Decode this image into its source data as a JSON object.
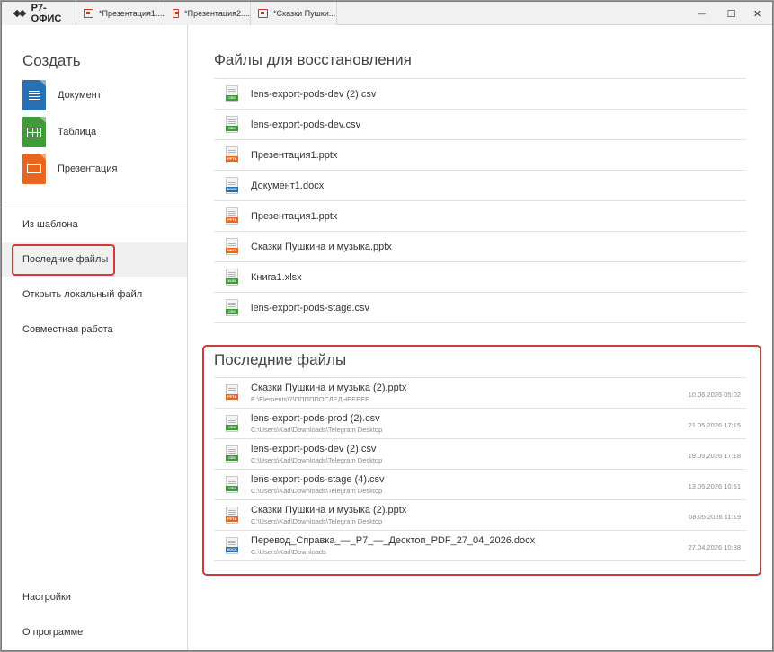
{
  "titlebar": {
    "brand": "Р7-ОФИС",
    "tabs": [
      {
        "label": "*Презентация1...."
      },
      {
        "label": "*Презентация2...."
      },
      {
        "label": "*Сказки Пушки..."
      }
    ],
    "minimize": "—",
    "maximize": "☐",
    "close": "✕"
  },
  "sidebar": {
    "create_title": "Создать",
    "create_items": [
      {
        "label": "Документ",
        "color": "#2a6fb0"
      },
      {
        "label": "Таблица",
        "color": "#3f9a3a"
      },
      {
        "label": "Презентация",
        "color": "#e9661f"
      }
    ],
    "nav": [
      {
        "label": "Из шаблона"
      },
      {
        "label": "Последние файлы"
      },
      {
        "label": "Открыть локальный файл"
      },
      {
        "label": "Совместная работа"
      }
    ],
    "bottom": [
      {
        "label": "Настройки"
      },
      {
        "label": "О программе"
      }
    ]
  },
  "recovery": {
    "title": "Файлы для восстановления",
    "files": [
      {
        "name": "lens-export-pods-dev (2).csv",
        "type": "CSV"
      },
      {
        "name": "lens-export-pods-dev.csv",
        "type": "CSV"
      },
      {
        "name": "Презентация1.pptx",
        "type": "PPTX"
      },
      {
        "name": "Документ1.docx",
        "type": "DOCX"
      },
      {
        "name": "Презентация1.pptx",
        "type": "PPTX"
      },
      {
        "name": "Сказки Пушкина и музыка.pptx",
        "type": "PPTX"
      },
      {
        "name": "Книга1.xlsx",
        "type": "XLSX"
      },
      {
        "name": "lens-export-pods-stage.csv",
        "type": "CSV"
      }
    ]
  },
  "recent": {
    "title": "Последние файлы",
    "files": [
      {
        "name": "Сказки Пушкина и музыка (2).pptx",
        "type": "PPTX",
        "path": "E:\\Elements\\7\\ПППППОСЛЕДНЕЕЕЕЕ",
        "date": "10.06.2026 05:02"
      },
      {
        "name": "lens-export-pods-prod (2).csv",
        "type": "CSV",
        "path": "C:\\Users\\Kad\\Downloads\\Telegram Desktop",
        "date": "21.05.2026 17:15"
      },
      {
        "name": "lens-export-pods-dev (2).csv",
        "type": "CSV",
        "path": "C:\\Users\\Kad\\Downloads\\Telegram Desktop",
        "date": "19.05.2026 17:18"
      },
      {
        "name": "lens-export-pods-stage (4).csv",
        "type": "CSV",
        "path": "C:\\Users\\Kad\\Downloads\\Telegram Desktop",
        "date": "13.05.2026 10:51"
      },
      {
        "name": "Сказки Пушкина и музыка (2).pptx",
        "type": "PPTX",
        "path": "C:\\Users\\Kad\\Downloads\\Telegram Desktop",
        "date": "08.05.2026 11:19"
      },
      {
        "name": "Перевод_Справка_—_Р7_—_Десктоп_PDF_27_04_2026.docx",
        "type": "DOCX",
        "path": "C:\\Users\\Kad\\Downloads",
        "date": "27.04.2026 10:38"
      }
    ]
  },
  "type_colors": {
    "CSV": "#3f9a3a",
    "XLSX": "#3f9a3a",
    "PPTX": "#e9661f",
    "DOCX": "#2a6fb0"
  }
}
